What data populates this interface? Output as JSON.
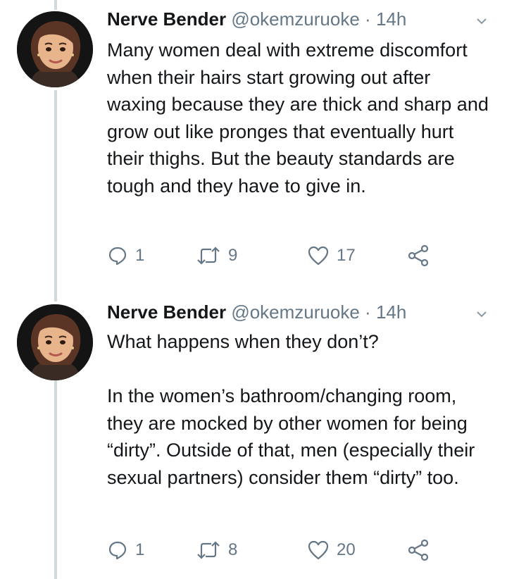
{
  "tweets": [
    {
      "author_name": "Nerve Bender",
      "handle": "@okemzuruoke",
      "separator": "·",
      "time": "14h",
      "avatar_icon": "memoji-avatar-icon",
      "paragraphs": [
        "Many women deal with extreme discomfort when their hairs start growing out after waxing because they are thick and sharp and grow out like pronges that eventually hurt their thighs. But the beauty standards are tough and they have to give in."
      ],
      "replies": "1",
      "retweets": "9",
      "likes": "17"
    },
    {
      "author_name": "Nerve Bender",
      "handle": "@okemzuruoke",
      "separator": "·",
      "time": "14h",
      "avatar_icon": "memoji-avatar-icon",
      "paragraphs": [
        "What happens when they don’t?",
        "In the women’s bathroom/changing room, they are mocked by other women for being “dirty”. Outside of that, men (especially their sexual partners) consider them “dirty” too."
      ],
      "replies": "1",
      "retweets": "8",
      "likes": "20"
    }
  ],
  "colors": {
    "text": "#14171a",
    "secondary": "#657786",
    "thread_line": "#cfd9de",
    "avatar_bg": "#141414"
  },
  "icons": [
    "reply-icon",
    "retweet-icon",
    "like-icon",
    "share-icon",
    "chevron-down-icon"
  ]
}
